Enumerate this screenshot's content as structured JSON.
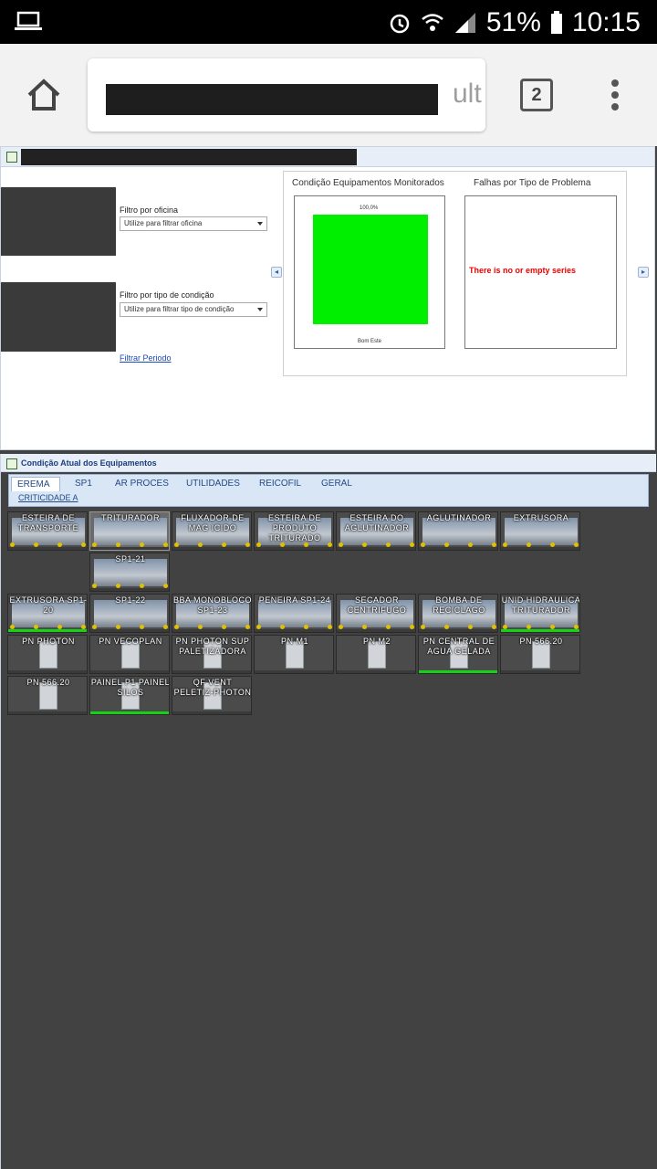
{
  "status_bar": {
    "battery": "51%",
    "time": "10:15"
  },
  "browser": {
    "url_visible": "ult",
    "tab_count": "2"
  },
  "filters": {
    "oficina_label": "Filtro por oficina",
    "oficina_placeholder": "Utilize para filtrar oficina",
    "condicao_label": "Filtro por tipo de condição",
    "condicao_placeholder": "Utilize para filtrar tipo de condição",
    "periodo_link": "Filtrar Periodo"
  },
  "charts": {
    "left_title": "Condição Equipamentos Monitorados",
    "right_title": "Falhas por Tipo de Problema",
    "right_error": "There is no or empty series"
  },
  "chart_data": {
    "type": "bar",
    "categories": [
      "Bom Este"
    ],
    "values": [
      100.0
    ],
    "data_labels": [
      "100,0%"
    ],
    "ylim": [
      0,
      100
    ],
    "colors": [
      "#00ee00"
    ]
  },
  "equipment_panel": {
    "title": "Condição Atual dos Equipamentos",
    "tabs": [
      "EREMA",
      "SP1",
      "AR PROCES",
      "UTILIDADES",
      "REICOFIL",
      "GERAL"
    ],
    "active_tab": "EREMA",
    "subtab": "CRITICIDADE A"
  },
  "tiles": [
    {
      "label": "ESTEIRA DE TRANSPORTE",
      "status": "none"
    },
    {
      "label": "TRITURADOR",
      "status": "none"
    },
    {
      "label": "FLUXADOR DE MAG ICIDO",
      "status": "none"
    },
    {
      "label": "ESTEIRA DE PRODUTO TRITURADO",
      "status": "none"
    },
    {
      "label": "ESTEIRA DO AGLUTINADOR",
      "status": "none"
    },
    {
      "label": "AGLUTINADOR",
      "status": "none"
    },
    {
      "label": "EXTRUSORA",
      "status": "none"
    },
    {
      "label": "SP1-21",
      "status": "none"
    },
    {
      "label": "EXTRUSORA SP1-20",
      "status": "ok"
    },
    {
      "label": "SP1-22",
      "status": "none"
    },
    {
      "label": "BBA MONOBLOCO SP1-23",
      "status": "none"
    },
    {
      "label": "PENEIRA SP1-24",
      "status": "none"
    },
    {
      "label": "SECADOR CENTRIFUGO",
      "status": "none"
    },
    {
      "label": "BOMBA DE RECICLAGO",
      "status": "none"
    },
    {
      "label": "UNID HIDRAULICA TRITURADOR",
      "status": "ok"
    },
    {
      "label": "PN PHOTON",
      "status": "none"
    },
    {
      "label": "PN VECOPLAN",
      "status": "none"
    },
    {
      "label": "PN PHOTON SUP PALETIZADORA",
      "status": "none"
    },
    {
      "label": "PN M1",
      "status": "none"
    },
    {
      "label": "PN M2",
      "status": "none"
    },
    {
      "label": "PN CENTRAL DE AGUA GELADA",
      "status": "ok"
    },
    {
      "label": "PN 566.20",
      "status": "none"
    },
    {
      "label": "PN 566.20",
      "status": "none"
    },
    {
      "label": "PAINEL P1 PAINEL SILOS",
      "status": "ok"
    },
    {
      "label": "QF VENT PELETIZ-PHOTON",
      "status": "none"
    }
  ]
}
